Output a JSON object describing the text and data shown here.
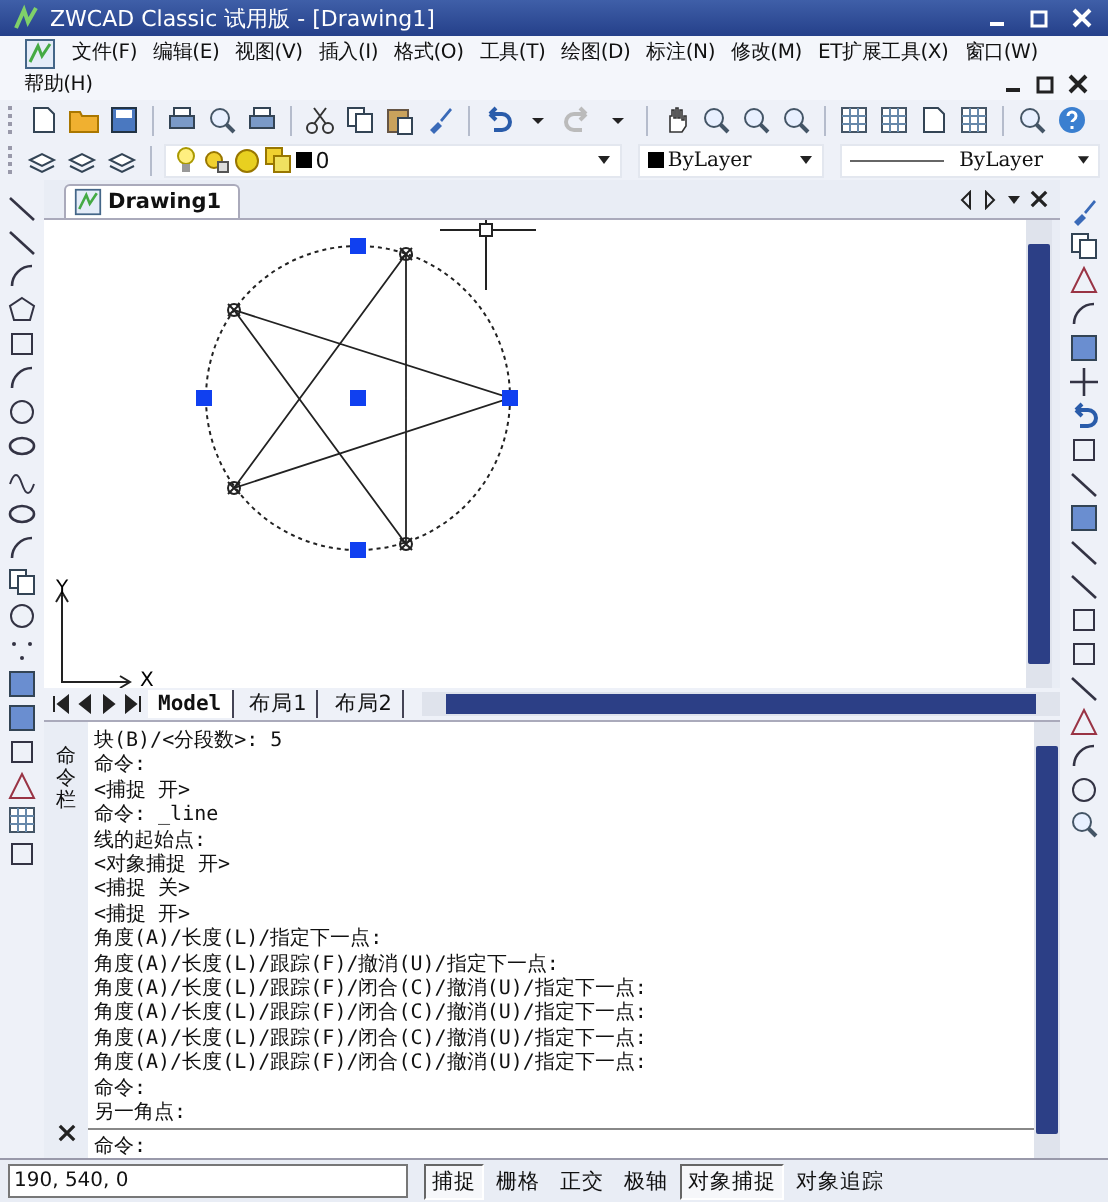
{
  "window": {
    "title": "ZWCAD Classic 试用版 - [Drawing1]"
  },
  "menu": [
    "文件(F)",
    "编辑(E)",
    "视图(V)",
    "插入(I)",
    "格式(O)",
    "工具(T)",
    "绘图(D)",
    "标注(N)",
    "修改(M)",
    "ET扩展工具(X)",
    "窗口(W)",
    "帮助(H)"
  ],
  "properties_bar": {
    "layer": "0",
    "color_setting": "ByLayer",
    "linetype": "ByLayer"
  },
  "document_tab": {
    "title": "Drawing1"
  },
  "canvas": {
    "ucs_x_label": "X",
    "ucs_y_label": "Y"
  },
  "layout_tabs": [
    {
      "label": "Model",
      "selected": true
    },
    {
      "label": "布局1",
      "selected": false
    },
    {
      "label": "布局2",
      "selected": false
    }
  ],
  "command_panel": {
    "title": "命令栏",
    "history": [
      "块(B)/<分段数>: 5",
      "命令:",
      "<捕捉 开>",
      "命令: _line",
      "线的起始点:",
      "<对象捕捉 开>",
      "<捕捉 关>",
      "<捕捉 开>",
      "角度(A)/长度(L)/指定下一点:",
      "角度(A)/长度(L)/跟踪(F)/撤消(U)/指定下一点:",
      "角度(A)/长度(L)/跟踪(F)/闭合(C)/撤消(U)/指定下一点:",
      "角度(A)/长度(L)/跟踪(F)/闭合(C)/撤消(U)/指定下一点:",
      "角度(A)/长度(L)/跟踪(F)/闭合(C)/撤消(U)/指定下一点:",
      "角度(A)/长度(L)/跟踪(F)/闭合(C)/撤消(U)/指定下一点:",
      "命令:",
      "另一角点:"
    ],
    "prompt": "命令:"
  },
  "status_bar": {
    "coordinates": "190, 540, 0",
    "toggles": [
      {
        "label": "捕捉",
        "on": true
      },
      {
        "label": "栅格",
        "on": false
      },
      {
        "label": "正交",
        "on": false
      },
      {
        "label": "极轴",
        "on": false
      },
      {
        "label": "对象捕捉",
        "on": true
      },
      {
        "label": "对象追踪",
        "on": false
      }
    ]
  }
}
